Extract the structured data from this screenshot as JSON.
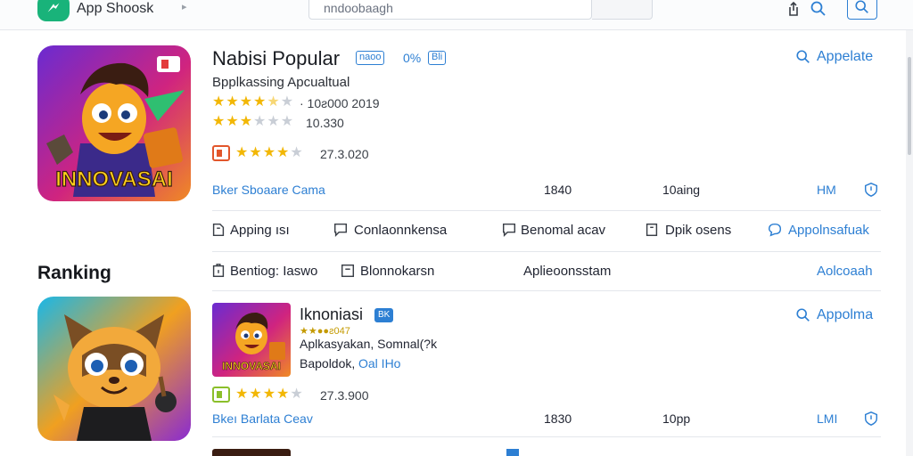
{
  "topbar": {
    "brand": "App Shoosk",
    "search_value": "nndoobaagh"
  },
  "featured": {
    "title": "Nabisi Popular",
    "badge_outline": "naoo",
    "badge_pct": "0%",
    "badge_blue": "Bli",
    "subtitle": "Bpplkassing Apcualtual",
    "rating_rows": [
      {
        "stars": 4.5,
        "value": "· 10ƨ000 2019"
      },
      {
        "stars": 3,
        "value": "10.330"
      },
      {
        "stars": 4,
        "value": "27.3.020"
      }
    ],
    "action_link": "Appelate",
    "meta_left": "Bker Sboaare Cama",
    "meta_col1": "1840",
    "meta_col2": "10aing",
    "meta_right": "HM",
    "logo_text": "INNOVASAI",
    "accent": "#2d7fd3"
  },
  "tabs_row1": [
    {
      "label": "Apping ısı"
    },
    {
      "label": "Conlaonnkensa"
    },
    {
      "label": "Benomal acav"
    },
    {
      "label": "Dpik osens"
    },
    {
      "label": "Appolnsafuak"
    }
  ],
  "ranking": {
    "heading": "Ranking",
    "tabs": [
      {
        "label": "Bentiog: Iaswo"
      },
      {
        "label": "Blonnokarsn"
      },
      {
        "label": "Aplieoonsstam"
      },
      {
        "label": "Aolcoaah"
      }
    ]
  },
  "item2": {
    "title": "Iknoniasi",
    "badge": "BK",
    "rating_line": "★★●●ƨ047",
    "desc_line1": "Aplkasyakan, Somnal(?k",
    "desc_line2_a": "Bapoldok,",
    "desc_line2_b": "Oal IHo",
    "rating_stars": 4,
    "rating_value": "27.3.900",
    "action_link": "Appolma",
    "meta_left": "Bkeı Barlata Ceav",
    "meta_col1": "1830",
    "meta_col2": "10pp",
    "meta_right": "LMI",
    "thumb_text": "INNOVASAI"
  }
}
